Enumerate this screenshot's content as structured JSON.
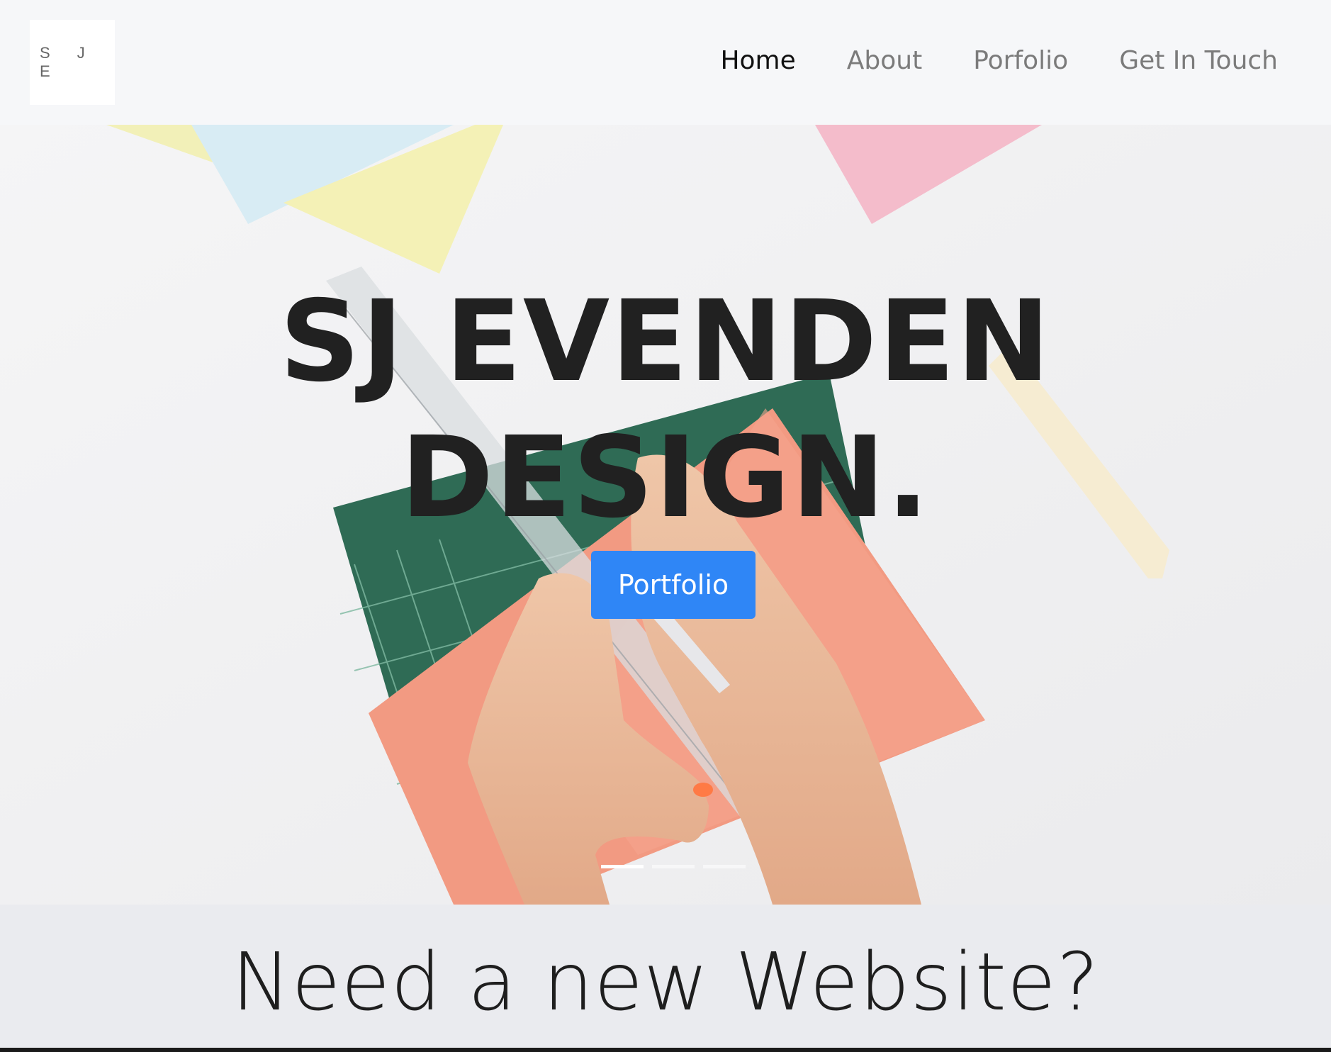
{
  "logo": {
    "text": "S J E"
  },
  "nav": {
    "items": [
      {
        "label": "Home",
        "active": true
      },
      {
        "label": "About",
        "active": false
      },
      {
        "label": "Porfolio",
        "active": false
      },
      {
        "label": "Get In Touch",
        "active": false
      }
    ]
  },
  "hero": {
    "title_line1": "SJ EVENDEN",
    "title_line2": "DESIGN.",
    "button_label": "Portfolio",
    "slides": 3,
    "active_slide": 1
  },
  "tagline": {
    "text": "Need a new Website?"
  },
  "colors": {
    "accent": "#2f86f6",
    "nav_active": "#111111",
    "nav_inactive": "#7b7b7b",
    "title": "#212121"
  }
}
